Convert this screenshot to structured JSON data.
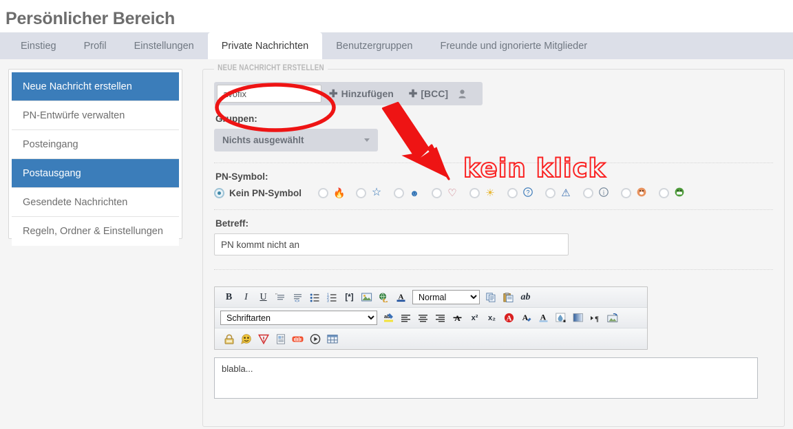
{
  "header": {
    "title": "Persönlicher Bereich"
  },
  "tabs": [
    {
      "label": "Einstieg",
      "active": false
    },
    {
      "label": "Profil",
      "active": false
    },
    {
      "label": "Einstellungen",
      "active": false
    },
    {
      "label": "Private Nachrichten",
      "active": true
    },
    {
      "label": "Benutzergruppen",
      "active": false
    },
    {
      "label": "Freunde und ignorierte Mitglieder",
      "active": false
    }
  ],
  "sidebar": {
    "items": [
      {
        "label": "Neue Nachricht erstellen",
        "selected": true
      },
      {
        "label": "PN-Entwürfe verwalten",
        "selected": false
      },
      {
        "label": "Posteingang",
        "selected": false
      },
      {
        "label": "Postausgang",
        "selected": true
      },
      {
        "label": "Gesendete Nachrichten",
        "selected": false
      },
      {
        "label": "Regeln, Ordner & Einstellungen",
        "selected": false
      }
    ]
  },
  "form": {
    "legend": "NEUE NACHRICHT ERSTELLEN",
    "recipient": {
      "value": "avofix",
      "placeholder": "",
      "add_label": "Hinzufügen",
      "bcc_label": "[BCC]",
      "plus": "✚"
    },
    "groups": {
      "label": "Gruppen:",
      "selected": "Nichts ausgewählt"
    },
    "pn_symbol": {
      "label": "PN-Symbol:",
      "options": [
        {
          "label": "Kein PN-Symbol",
          "icon": "",
          "selected": true
        },
        {
          "label": "",
          "icon": "🔥",
          "icon_name": "fire-icon",
          "selected": false
        },
        {
          "label": "",
          "icon": "☆",
          "icon_name": "star-icon",
          "selected": false
        },
        {
          "label": "",
          "icon": "☻",
          "icon_name": "skull-icon",
          "selected": false
        },
        {
          "label": "",
          "icon": "♡",
          "icon_name": "heart-icon",
          "selected": false
        },
        {
          "label": "",
          "icon": "☀",
          "icon_name": "lightbulb-icon",
          "selected": false
        },
        {
          "label": "",
          "icon": "?",
          "icon_name": "question-icon",
          "selected": false
        },
        {
          "label": "",
          "icon": "⚠",
          "icon_name": "warning-icon",
          "selected": false
        },
        {
          "label": "",
          "icon": "i",
          "icon_name": "info-icon",
          "selected": false
        },
        {
          "label": "",
          "icon": "☹",
          "icon_name": "sad-smiley-icon",
          "selected": false
        },
        {
          "label": "",
          "icon": "☺",
          "icon_name": "green-smiley-icon",
          "selected": false
        }
      ]
    },
    "subject": {
      "label": "Betreff:",
      "value": "PN kommt nicht an",
      "placeholder": ""
    },
    "editor": {
      "format_select": "Normal",
      "font_select": "Schriftarten",
      "row1": [
        {
          "name": "bold-button",
          "glyph": "B"
        },
        {
          "name": "italic-button",
          "glyph": "I"
        },
        {
          "name": "underline-button",
          "glyph": "U"
        },
        {
          "name": "quote-button",
          "glyph": "❝"
        },
        {
          "name": "code-button",
          "glyph": "<>"
        },
        {
          "name": "unordered-list-button",
          "glyph": "☰"
        },
        {
          "name": "ordered-list-button",
          "glyph": "☷"
        },
        {
          "name": "footnote-button",
          "glyph": "[*]"
        },
        {
          "name": "insert-image-button",
          "glyph": "🖼"
        },
        {
          "name": "insert-link-button",
          "glyph": "🌐"
        },
        {
          "name": "font-color-button",
          "glyph": "A"
        }
      ],
      "row1_right": [
        {
          "name": "copy-button",
          "glyph": "📄"
        },
        {
          "name": "paste-button",
          "glyph": "📋"
        },
        {
          "name": "spellcheck-button",
          "glyph": "ab"
        }
      ],
      "row2": [
        {
          "name": "highlight-button",
          "glyph": "ab"
        },
        {
          "name": "align-left-button",
          "glyph": "≡"
        },
        {
          "name": "align-center-button",
          "glyph": "▤"
        },
        {
          "name": "align-right-button",
          "glyph": "≡"
        },
        {
          "name": "justify-button",
          "glyph": "≡"
        },
        {
          "name": "clear-format-button",
          "glyph": "A"
        },
        {
          "name": "superscript-button",
          "glyph": "x²"
        },
        {
          "name": "subscript-button",
          "glyph": "x₂"
        },
        {
          "name": "red-letter-button",
          "glyph": "A"
        },
        {
          "name": "text-color-button",
          "glyph": "A"
        },
        {
          "name": "text-background-button",
          "glyph": "A"
        },
        {
          "name": "color-picker-button",
          "glyph": "💧"
        },
        {
          "name": "gradient-button",
          "glyph": "▮"
        },
        {
          "name": "text-direction-button",
          "glyph": "¶"
        },
        {
          "name": "insert-media-button",
          "glyph": "🖼"
        }
      ],
      "row3": [
        {
          "name": "spoiler-lock-button",
          "glyph": "🔒"
        },
        {
          "name": "smiley-button",
          "glyph": "😊"
        },
        {
          "name": "warn-button",
          "glyph": "▽"
        },
        {
          "name": "info-page-button",
          "glyph": "📄"
        },
        {
          "name": "soundcloud-button",
          "glyph": "☁"
        },
        {
          "name": "video-button",
          "glyph": "▶"
        },
        {
          "name": "table-button",
          "glyph": "▦"
        }
      ]
    },
    "message": {
      "value": "blabla...",
      "placeholder": ""
    }
  },
  "annotations": {
    "callout_text": "kein klick",
    "highlight_color": "#fa2222"
  }
}
